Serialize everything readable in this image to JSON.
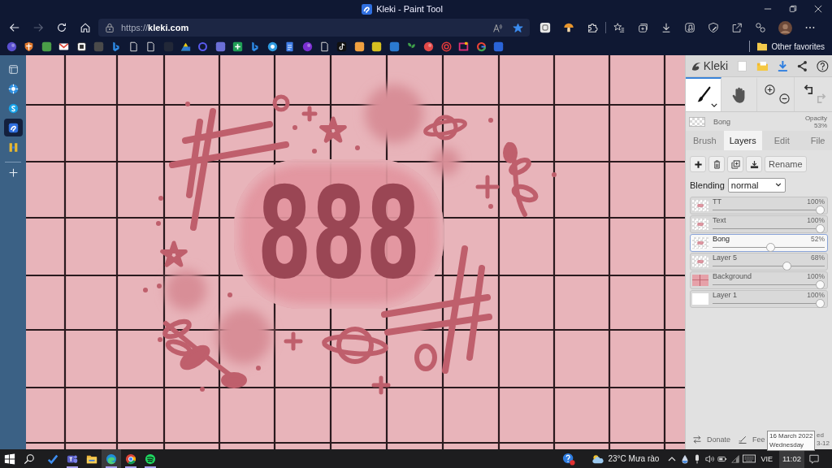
{
  "browser": {
    "title": "Kleki - Paint Tool",
    "navigation": [
      {
        "kind": "back",
        "disabled": false
      },
      {
        "kind": "forward",
        "disabled": true
      },
      {
        "kind": "reload",
        "disabled": false
      },
      {
        "kind": "home",
        "disabled": false
      }
    ],
    "url": "https://**kleki.com**",
    "favorited": true,
    "other_favorites": "Other favorites",
    "sidebar": [
      {
        "selected": false
      },
      {
        "selected": false
      },
      {
        "selected": false
      },
      {
        "selected": true
      },
      {
        "selected": false
      }
    ]
  },
  "kleki": {
    "logo": "Kleki",
    "tools": [
      {
        "kind": "brush",
        "selected": true
      },
      {
        "kind": "hand",
        "selected": false
      }
    ],
    "undo": {
      "disabled": false
    },
    "redo": {
      "disabled": true
    },
    "current_layer": {
      "name": "Bong",
      "opacity_label": "Opacity",
      "opacity": "53%"
    },
    "tabs": [
      {
        "label": "Brush",
        "selected": false
      },
      {
        "label": "Layers",
        "selected": true
      },
      {
        "label": "Edit",
        "selected": false
      },
      {
        "label": "File",
        "selected": false
      }
    ],
    "rename": "Rename",
    "blending": {
      "label": "Blending",
      "value": "normal"
    },
    "layers": [
      {
        "kind": "transparent",
        "name": "TT",
        "opacity": "100%",
        "level": 1,
        "selected": false
      },
      {
        "kind": "transparent",
        "name": "Text",
        "opacity": "100%",
        "level": 1,
        "selected": false
      },
      {
        "kind": "transparent",
        "name": "Bong",
        "opacity": "52%",
        "level": 0.52,
        "selected": true
      },
      {
        "kind": "transparent",
        "name": "Layer 5",
        "opacity": "68%",
        "level": 0.68,
        "selected": false
      },
      {
        "kind": "grid",
        "name": "Background",
        "opacity": "100%",
        "level": 1,
        "selected": false
      },
      {
        "kind": "blank",
        "name": "Layer 1",
        "opacity": "100%",
        "level": 1,
        "selected": false
      }
    ],
    "footer": {
      "donate": "Donate",
      "feedback": "Fee",
      "updated": [
        "ed",
        "3-12"
      ]
    }
  },
  "canvas": {
    "text": "888"
  },
  "tooltip": {
    "lines": [
      "16 March 2022",
      "Wednesday"
    ]
  },
  "taskbar": {
    "apps": [
      {
        "running": false,
        "selected": false
      },
      {
        "running": true,
        "selected": false
      },
      {
        "running": false,
        "selected": false
      },
      {
        "running": true,
        "selected": true
      },
      {
        "running": true,
        "selected": false
      },
      {
        "running": true,
        "selected": false
      }
    ],
    "weather": "23°C Mưa rào",
    "language": "VIE",
    "clock": {
      "time": "11:02",
      "hovered": true
    }
  }
}
